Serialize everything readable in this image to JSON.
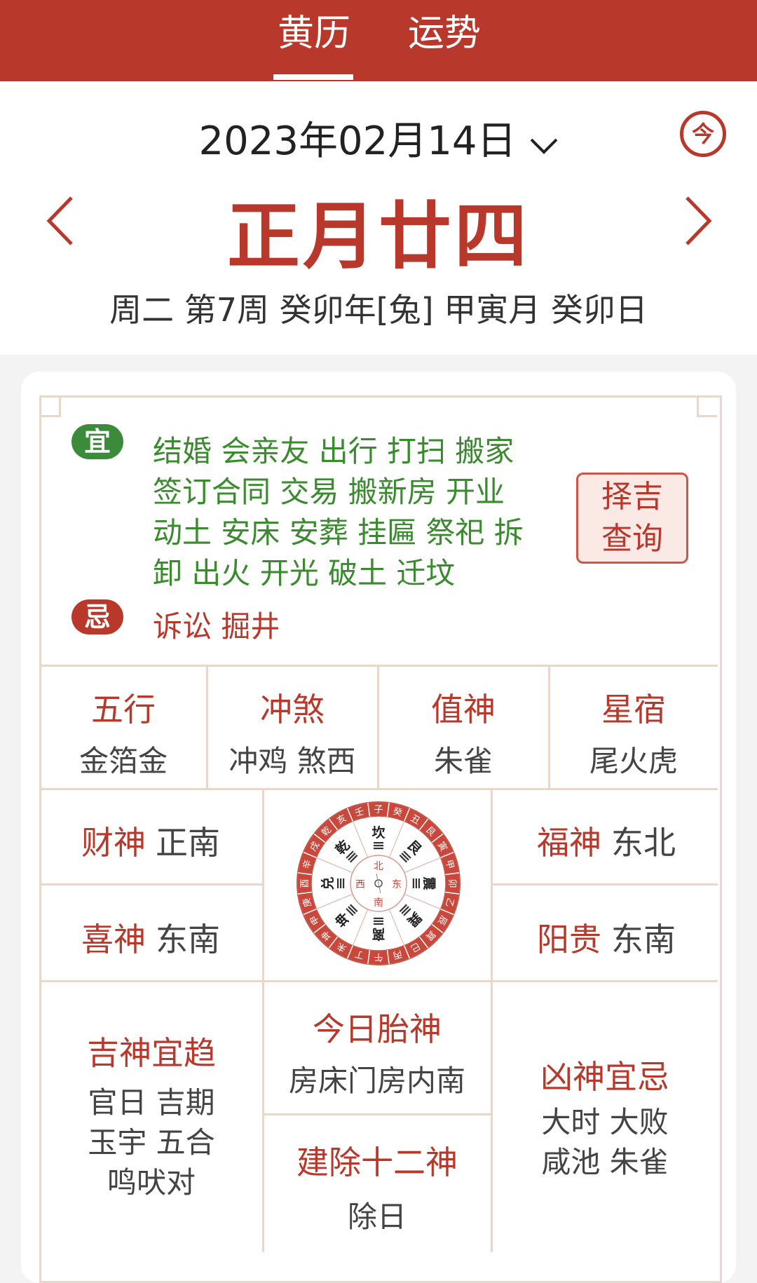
{
  "tabs": [
    {
      "label": "黄历",
      "active": true
    },
    {
      "label": "运势",
      "active": false
    }
  ],
  "date": {
    "solar": "2023年02月14日",
    "today_label": "今",
    "lunar": "正月廿四",
    "details": "周二 第7周 癸卯年[兔] 甲寅月 癸卯日"
  },
  "yi": {
    "badge": "宜",
    "lines": [
      "结婚 会亲友 出行 打扫 搬家",
      "签订合同 交易 搬新房 开业",
      "动土 安床 安葬 挂匾 祭祀 拆",
      "卸 出火 开光 破土 迁坟"
    ]
  },
  "ji": {
    "badge": "忌",
    "text": "诉讼 掘井"
  },
  "zeji_button": {
    "line1": "择吉",
    "line2": "查询"
  },
  "row1": [
    {
      "title": "五行",
      "value": "金箔金"
    },
    {
      "title": "冲煞",
      "value": "冲鸡 煞西"
    },
    {
      "title": "值神",
      "value": "朱雀"
    },
    {
      "title": "星宿",
      "value": "尾火虎"
    }
  ],
  "gods": {
    "caishen": {
      "label": "财神",
      "dir": "正南"
    },
    "xishen": {
      "label": "喜神",
      "dir": "东南"
    },
    "fushen": {
      "label": "福神",
      "dir": "东北"
    },
    "yanggui": {
      "label": "阳贵",
      "dir": "东南"
    }
  },
  "compass": {
    "outer": [
      "子",
      "癸",
      "丑",
      "艮",
      "寅",
      "甲",
      "卯",
      "乙",
      "辰",
      "巽",
      "巳",
      "丙",
      "午",
      "丁",
      "未",
      "坤",
      "申",
      "庚",
      "酉",
      "辛",
      "戌",
      "乾",
      "亥",
      "壬"
    ],
    "trigrams": [
      "坎",
      "艮",
      "震",
      "巽",
      "离",
      "坤",
      "兑",
      "乾"
    ],
    "inner": [
      "北",
      "东",
      "南",
      "西"
    ]
  },
  "jishen": {
    "title": "吉神宜趋",
    "lines": [
      "官日 吉期",
      "玉宇 五合",
      "鸣吠对"
    ]
  },
  "taishen": {
    "title": "今日胎神",
    "value": "房床门房内南"
  },
  "jianchu": {
    "title": "建除十二神",
    "value": "除日"
  },
  "xiongshen": {
    "title": "凶神宜忌",
    "lines": [
      "大时 大败",
      "咸池 朱雀"
    ]
  },
  "colors": {
    "brand_red": "#b8392c",
    "yi_green": "#3a8a2e",
    "frame": "#e7d7cd"
  }
}
